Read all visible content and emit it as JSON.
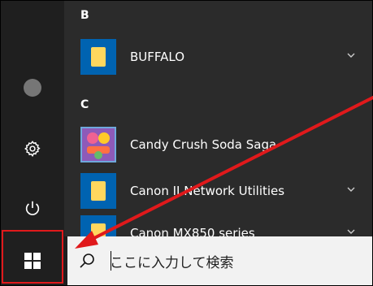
{
  "start_menu": {
    "sections": [
      {
        "letter": "B",
        "apps": [
          {
            "name": "BUFFALO",
            "expandable": true,
            "icon": "folder-icon"
          }
        ]
      },
      {
        "letter": "C",
        "apps": [
          {
            "name": "Candy Crush Soda Saga",
            "expandable": false,
            "icon": "candy-crush-icon"
          },
          {
            "name": "Canon IJ Network Utilities",
            "expandable": true,
            "icon": "folder-icon"
          },
          {
            "name": "Canon MX850 series",
            "expandable": true,
            "icon": "folder-icon"
          }
        ]
      }
    ],
    "rail": [
      "user-avatar-icon",
      "settings-gear-icon",
      "power-icon"
    ]
  },
  "taskbar": {
    "search_placeholder": "ここに入力して検索",
    "start_button_icon": "windows-logo-icon"
  },
  "colors": {
    "annotation": "#e0191b",
    "tile": "#0063b1",
    "folder": "#ffd75e"
  }
}
